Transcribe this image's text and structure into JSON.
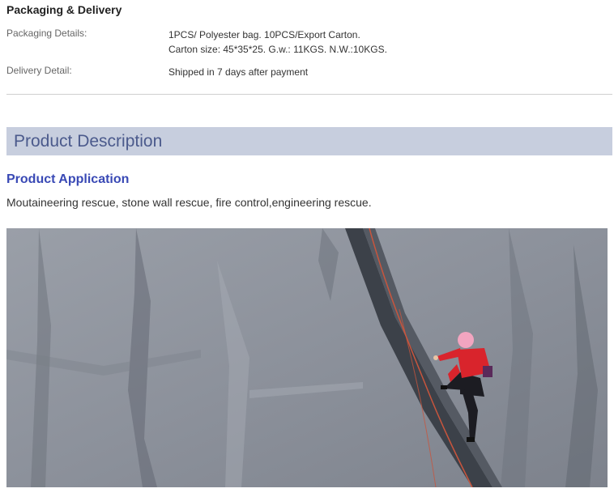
{
  "packaging_delivery": {
    "title": "Packaging & Delivery",
    "packaging_label": "Packaging Details:",
    "packaging_line1": "1PCS/ Polyester bag. 10PCS/Export Carton.",
    "packaging_line2": "Carton size: 45*35*25. G.w.: 11KGS. N.W.:10KGS.",
    "delivery_label": "Delivery Detail:",
    "delivery_value": "Shipped in 7 days after payment"
  },
  "description": {
    "header": "Product Description",
    "application_title": "Product Application",
    "application_text": "Moutaineering rescue, stone wall rescue, fire control,engineering rescue."
  },
  "photo": {
    "subject": "climber-on-rock-wall",
    "rock_color": "#8e939c",
    "jacket_color": "#d9242c",
    "helmet_color": "#f2a5c0"
  }
}
